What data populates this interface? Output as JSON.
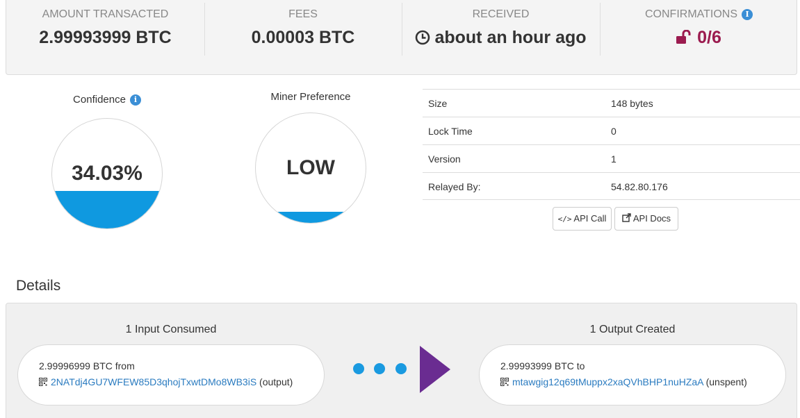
{
  "stats": {
    "amount": {
      "label": "AMOUNT TRANSACTED",
      "value": "2.99993999 BTC"
    },
    "fees": {
      "label": "FEES",
      "value": "0.00003 BTC"
    },
    "received": {
      "label": "RECEIVED",
      "value": "about an hour ago"
    },
    "confirmations": {
      "label": "CONFIRMATIONS",
      "value": "0/6"
    }
  },
  "confidence": {
    "title": "Confidence",
    "value": "34.03%",
    "fill_fraction": 0.3403
  },
  "miner_preference": {
    "title": "Miner Preference",
    "value": "LOW",
    "fill_fraction": 0.1
  },
  "properties": [
    {
      "key": "Size",
      "value": "148 bytes"
    },
    {
      "key": "Lock Time",
      "value": "0"
    },
    {
      "key": "Version",
      "value": "1"
    },
    {
      "key": "Relayed By:",
      "value": "54.82.80.176"
    }
  ],
  "buttons": {
    "api_call": "API Call",
    "api_docs": "API Docs"
  },
  "details": {
    "heading": "Details",
    "inputs_title": "1 Input Consumed",
    "outputs_title": "1 Output Created",
    "input": {
      "amount": "2.99996999 BTC from",
      "address": "2NATdj4GU7WFEW85D3qhojTxwtDMo8WB3iS",
      "suffix": "(output)"
    },
    "output": {
      "amount": "2.99993999 BTC to",
      "address": "mtawgig12q69tMuppx2xaQVhBHP1nuHZaA",
      "suffix": "(unspent)"
    }
  },
  "colors": {
    "accent_blue": "#0f99e0",
    "confirmations": "#9b1b4f",
    "arrow_purple": "#6a2c91",
    "link": "#2a7bc0"
  }
}
